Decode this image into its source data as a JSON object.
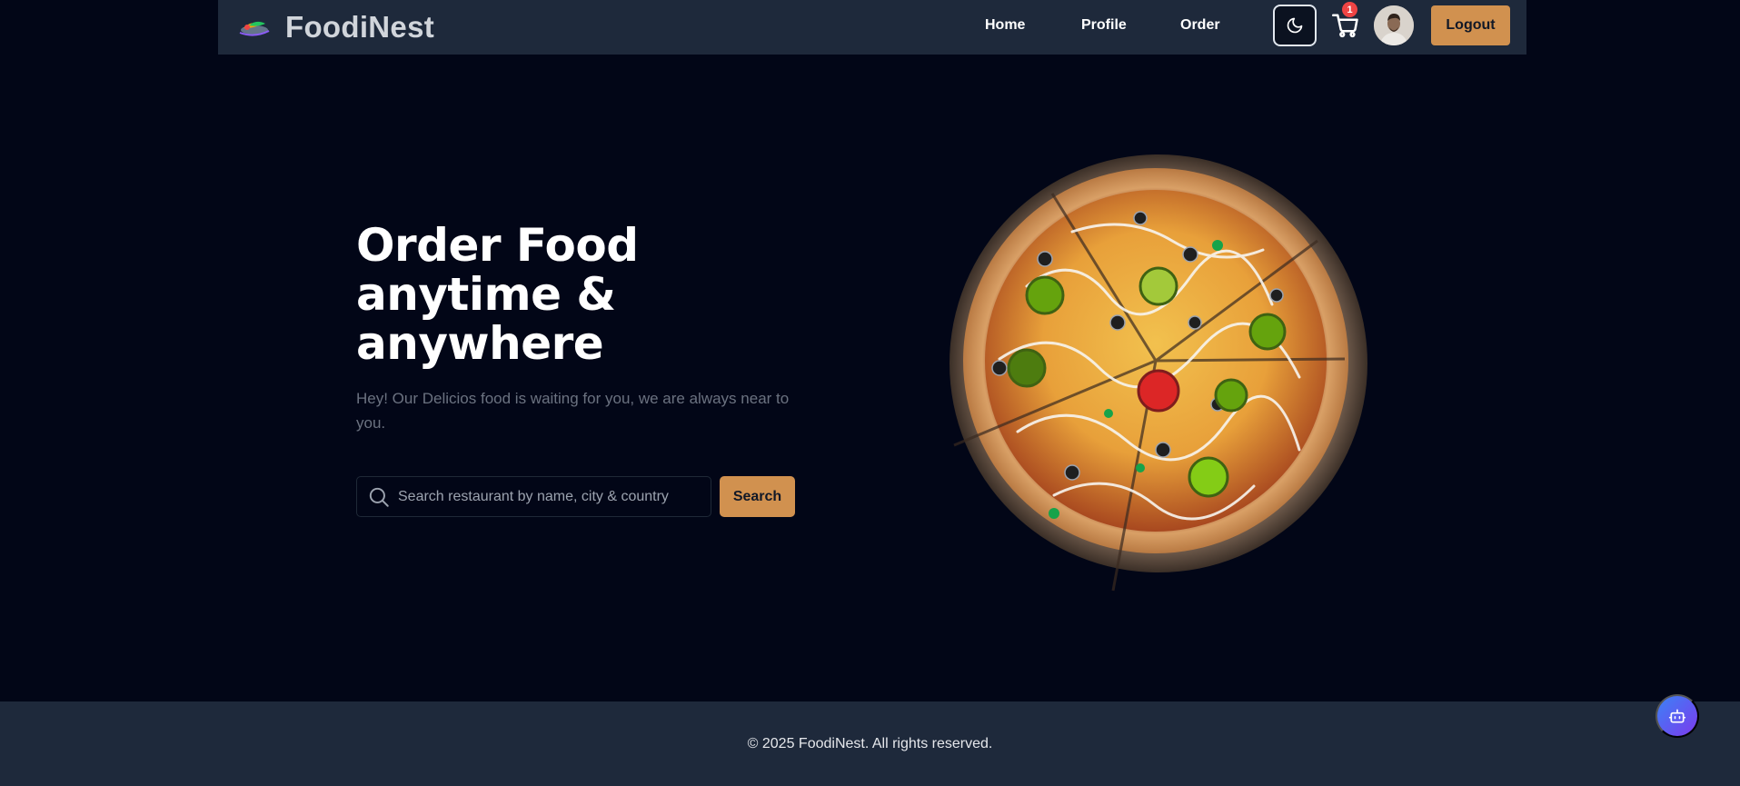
{
  "nav": {
    "brand": "FoodiNest",
    "links": [
      "Home",
      "Profile",
      "Order"
    ],
    "cart_count": "1",
    "logout_label": "Logout"
  },
  "hero": {
    "title": "Order Food anytime & anywhere",
    "subtitle": "Hey! Our Delicios food is waiting for you, we are always near to you.",
    "search_placeholder": "Search restaurant by name, city & country",
    "search_button": "Search"
  },
  "footer": {
    "copyright": "© 2025 FoodiNest. All rights reserved."
  },
  "icons": {
    "theme": "moon-icon",
    "cart": "cart-icon",
    "search": "search-icon",
    "chat": "bot-icon"
  },
  "colors": {
    "background": "#020617",
    "navbar": "#1e293b",
    "accent": "#d1914f",
    "badge": "#ef4444",
    "subtitle": "#6b7280"
  }
}
